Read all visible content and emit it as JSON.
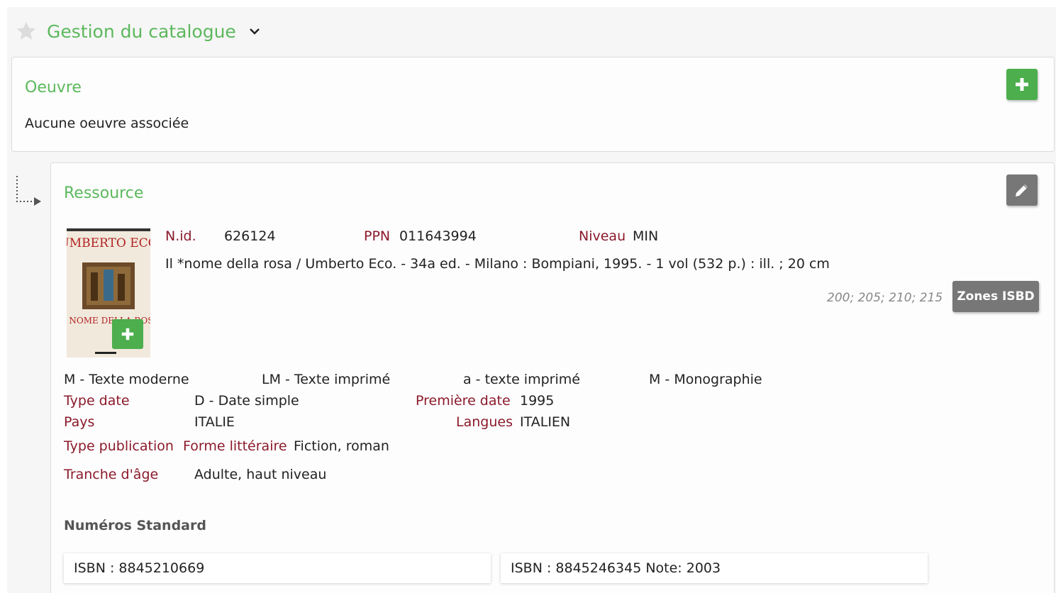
{
  "header": {
    "title": "Gestion du catalogue",
    "star_icon": "star-icon",
    "dropdown_icon": "chevron-down-icon"
  },
  "oeuvre": {
    "title": "Oeuvre",
    "empty_text": "Aucune oeuvre associée",
    "add_icon": "plus-icon"
  },
  "ressource": {
    "title": "Ressource",
    "edit_icon": "pencil-icon",
    "cover": {
      "author": "UMBERTO ECO",
      "title": "IL NOME DELLA ROSA"
    },
    "nid_label": "N.id.",
    "nid_value": "626124",
    "ppn_label": "PPN",
    "ppn_value": "011643994",
    "niveau_label": "Niveau",
    "niveau_value": "MIN",
    "description": "Il *nome della rosa / Umberto Eco. - 34a ed. - Milano : Bompiani, 1995. - 1 vol (532 p.) : ill. ; 20 cm",
    "isbd_zones": "200; 205; 210; 215",
    "isbd_button": "Zones ISBD",
    "codes": [
      "M - Texte moderne",
      "LM - Texte imprimé",
      "a - texte imprimé",
      "M - Monographie"
    ],
    "type_date_label": "Type date",
    "type_date_value": "D - Date simple",
    "premiere_date_label": "Première date",
    "premiere_date_value": "1995",
    "pays_label": "Pays",
    "pays_value": "ITALIE",
    "langues_label": "Langues",
    "langues_value": "ITALIEN",
    "type_publication_label": "Type publication",
    "forme_label": "Forme littéraire",
    "forme_value": "Fiction, roman",
    "tranche_label": "Tranche d'âge",
    "tranche_value": "Adulte, haut niveau",
    "numeros_title": "Numéros Standard",
    "isbns": [
      "ISBN : 8845210669",
      "ISBN : 8845246345 Note: 2003"
    ]
  },
  "colors": {
    "accent_green": "#5cb85c",
    "label_red": "#8b1a2b",
    "button_gray": "#777777"
  }
}
